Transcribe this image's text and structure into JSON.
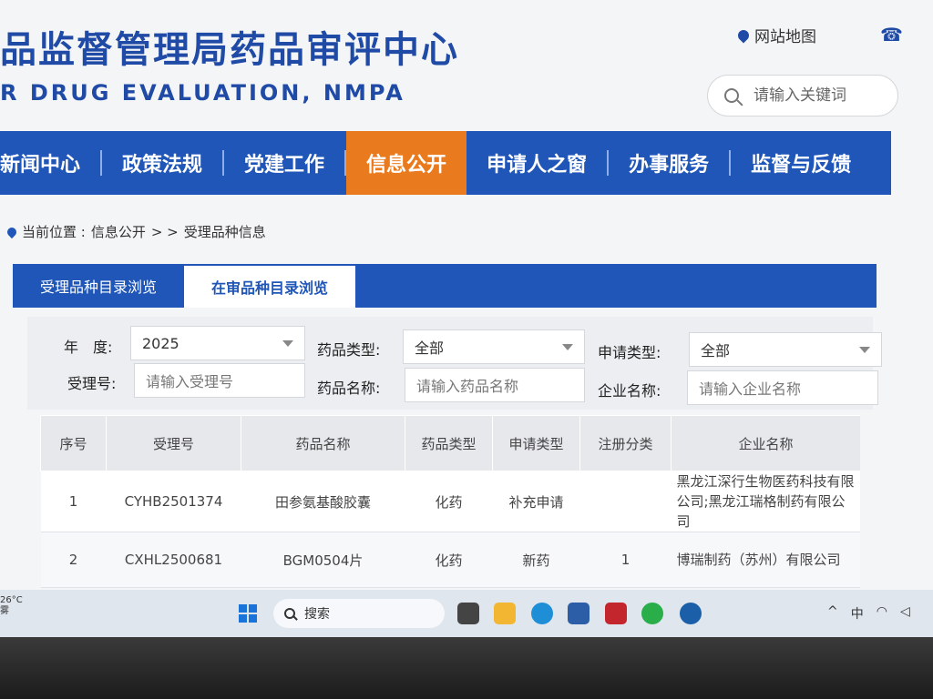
{
  "header": {
    "title": "品监督管理局药品审评中心",
    "subtitle": "R DRUG EVALUATION, NMPA",
    "sitemap_label": "网站地图",
    "search_placeholder": "请输入关键词"
  },
  "nav": {
    "items": [
      {
        "label": "新闻中心"
      },
      {
        "label": "政策法规"
      },
      {
        "label": "党建工作"
      },
      {
        "label": "信息公开"
      },
      {
        "label": "申请人之窗"
      },
      {
        "label": "办事服务"
      },
      {
        "label": "监督与反馈"
      }
    ],
    "active": "信息公开"
  },
  "breadcrumb": {
    "prefix": "当前位置 : ",
    "section": "信息公开",
    "sep": " > > ",
    "current": "受理品种信息"
  },
  "tabs": [
    {
      "label": "受理品种目录浏览"
    },
    {
      "label": "在审品种目录浏览"
    }
  ],
  "filters": {
    "year_label": "年　度:",
    "year_value": "2025",
    "drug_type_label": "药品类型:",
    "drug_type_value": "全部",
    "apply_type_label": "申请类型:",
    "apply_type_value": "全部",
    "accept_no_label": "受理号:",
    "accept_no_placeholder": "请输入受理号",
    "drug_name_label": "药品名称:",
    "drug_name_placeholder": "请输入药品名称",
    "company_label": "企业名称:",
    "company_placeholder": "请输入企业名称"
  },
  "table": {
    "headers": [
      "序号",
      "受理号",
      "药品名称",
      "药品类型",
      "申请类型",
      "注册分类",
      "企业名称"
    ],
    "rows": [
      [
        "1",
        "CYHB2501374",
        "田参氨基酸胶囊",
        "化药",
        "补充申请",
        "",
        "黑龙江深行生物医药科技有限公司;黑龙江瑞格制药有限公司"
      ],
      [
        "2",
        "CXHL2500681",
        "BGM0504片",
        "化药",
        "新药",
        "1",
        "博瑞制药（苏州）有限公司"
      ]
    ]
  },
  "taskbar": {
    "temperature": "26°C",
    "weather_text": "雾",
    "search_label": "搜索",
    "ime_label": "中"
  }
}
